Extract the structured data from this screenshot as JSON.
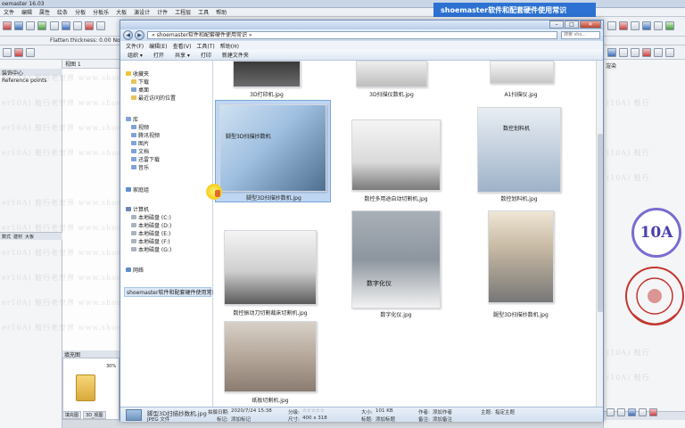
{
  "app": {
    "title": "oemaster 16.03",
    "menu": [
      "文件",
      "编辑",
      "属性",
      "绘条",
      "分板",
      "分板乐",
      "大板",
      "演设计",
      "计件",
      "工程层",
      "工具",
      "帮助"
    ],
    "flatten_label": "Flatten thickness: 0.00 None",
    "left_panel_title": "装饰中心",
    "left_panel_sub": "Reference points",
    "view_label": "视图 1",
    "left_tabs": [
      "数式",
      "建材",
      "大板"
    ],
    "thumb_title": "填充图",
    "thumb_percent": "30%",
    "bottom_tabs": [
      "填充图",
      "3D_视图"
    ],
    "right_panel_title": "渲染"
  },
  "banner": {
    "text": "shoemaster软件和配套硬件使用常识"
  },
  "explorer": {
    "address": "« shoemaster软件和配套硬件使用常识 »",
    "search_placeholder": "搜索 sho...",
    "menu": [
      "文件(F)",
      "编辑(E)",
      "查看(V)",
      "工具(T)",
      "帮助(H)"
    ],
    "commands": [
      "组织 ▾",
      "打开",
      "共享 ▾",
      "打印",
      "新建文件夹"
    ],
    "nav": {
      "favorites": "收藏夹",
      "downloads": "下载",
      "desktop": "桌面",
      "recent": "最近访问的位置",
      "libraries": "库",
      "videos": "视频",
      "pictures_alt": "腾讯视频",
      "pictures": "图片",
      "documents": "文档",
      "xunlei": "迅雷下载",
      "music": "音乐",
      "homegroup": "家庭组",
      "computer": "计算机",
      "disk_c": "本地磁盘 (C:)",
      "disk_d": "本地磁盘 (D:)",
      "disk_e": "本地磁盘 (E:)",
      "disk_f": "本地磁盘 (F:)",
      "disk_g": "本地磁盘 (G:)",
      "network": "网络",
      "folder": "shoemaster软件和配套硬件使用常识"
    },
    "files": [
      {
        "name": "3D打印机.jpg"
      },
      {
        "name": "3D扫描仪数机.jpg"
      },
      {
        "name": "A1扫描仪.jpg"
      },
      {
        "name": "脚型3D扫描抄数机.jpg",
        "overlay": "脚型3D扫描抄数机"
      },
      {
        "name": "数控多用途自动切割机.jpg"
      },
      {
        "name": "数控划料机.jpg",
        "overlay": "数控划料机"
      },
      {
        "name": "数控振动刀切割裁床切割机.jpg"
      },
      {
        "name": "数字化仪.jpg",
        "overlay": "数字化仪"
      },
      {
        "name": "腿型3D扫描抄数机.jpg"
      },
      {
        "name": "纸板切割机.jpg"
      }
    ],
    "details": {
      "filename": "脚型3D扫描抄数机.jpg",
      "type": "JPEG 文件",
      "taken_label": "拍摄日期:",
      "taken": "2020/7/24 15:38",
      "rating_label": "分级:",
      "stars": "☆☆☆☆☆",
      "dimensions_label": "尺寸:",
      "dimensions": "400 x 318",
      "size_label": "大小:",
      "size": "101 KB",
      "title_label": "标题:",
      "title": "添加标题",
      "tags_label": "标记:",
      "tags": "添加标记",
      "authors_label": "作者:",
      "authors": "添加作者",
      "comment_label": "备注:",
      "comment": "添加备注",
      "subject_label": "主题:",
      "subject": "指定主题"
    }
  },
  "stamp": {
    "logo_text": "10A"
  }
}
